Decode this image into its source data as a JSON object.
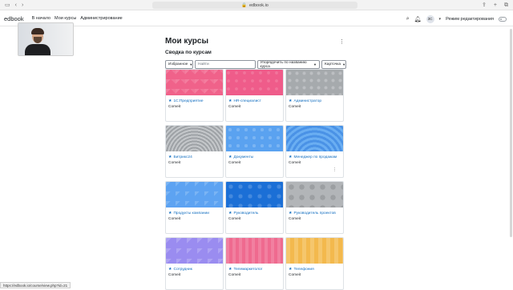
{
  "browser": {
    "url": "edbook.io",
    "back_icon": "chevron-left",
    "forward_icon": "chevron-right"
  },
  "navbar": {
    "brand": "edbook",
    "links": [
      "В начало",
      "Мои курсы",
      "Администрирование"
    ],
    "user_initials": "ЗС",
    "edit_mode_label": "Режим редактирования"
  },
  "page": {
    "title": "Мои курсы",
    "section_title": "Сводка по курсам"
  },
  "filters": {
    "grouping": "Избранное",
    "search_placeholder": "Найти",
    "sort": "Упорядочить по названию курса",
    "view": "Карточка"
  },
  "courses": [
    {
      "name": "1С:Предприятие",
      "org": "Comeit",
      "pattern": "pink"
    },
    {
      "name": "HR-специалист",
      "org": "Comeit",
      "pattern": "pink2"
    },
    {
      "name": "Администратор",
      "org": "Comeit",
      "pattern": "grey"
    },
    {
      "name": "Битрикс24",
      "org": "Comeit",
      "pattern": "grey-wave"
    },
    {
      "name": "Документы",
      "org": "Comeit",
      "pattern": "blue-hex"
    },
    {
      "name": "Менеджер по продажам",
      "org": "Comeit",
      "pattern": "blue-wave"
    },
    {
      "name": "Продукты компании",
      "org": "Comeit",
      "pattern": "blue-tri"
    },
    {
      "name": "Руководитель",
      "org": "Comeit",
      "pattern": "blue-dark"
    },
    {
      "name": "Руководитель проектов",
      "org": "Comeit",
      "pattern": "grey-circ"
    },
    {
      "name": "Сотрудник",
      "org": "Comeit",
      "pattern": "purple"
    },
    {
      "name": "Телемаркетолог",
      "org": "Comeit",
      "pattern": "pink-sq"
    },
    {
      "name": "Телефония",
      "org": "Comeit",
      "pattern": "yellow"
    }
  ],
  "statusbar": {
    "url": "https://edbook.io/course/view.php?id=21"
  }
}
